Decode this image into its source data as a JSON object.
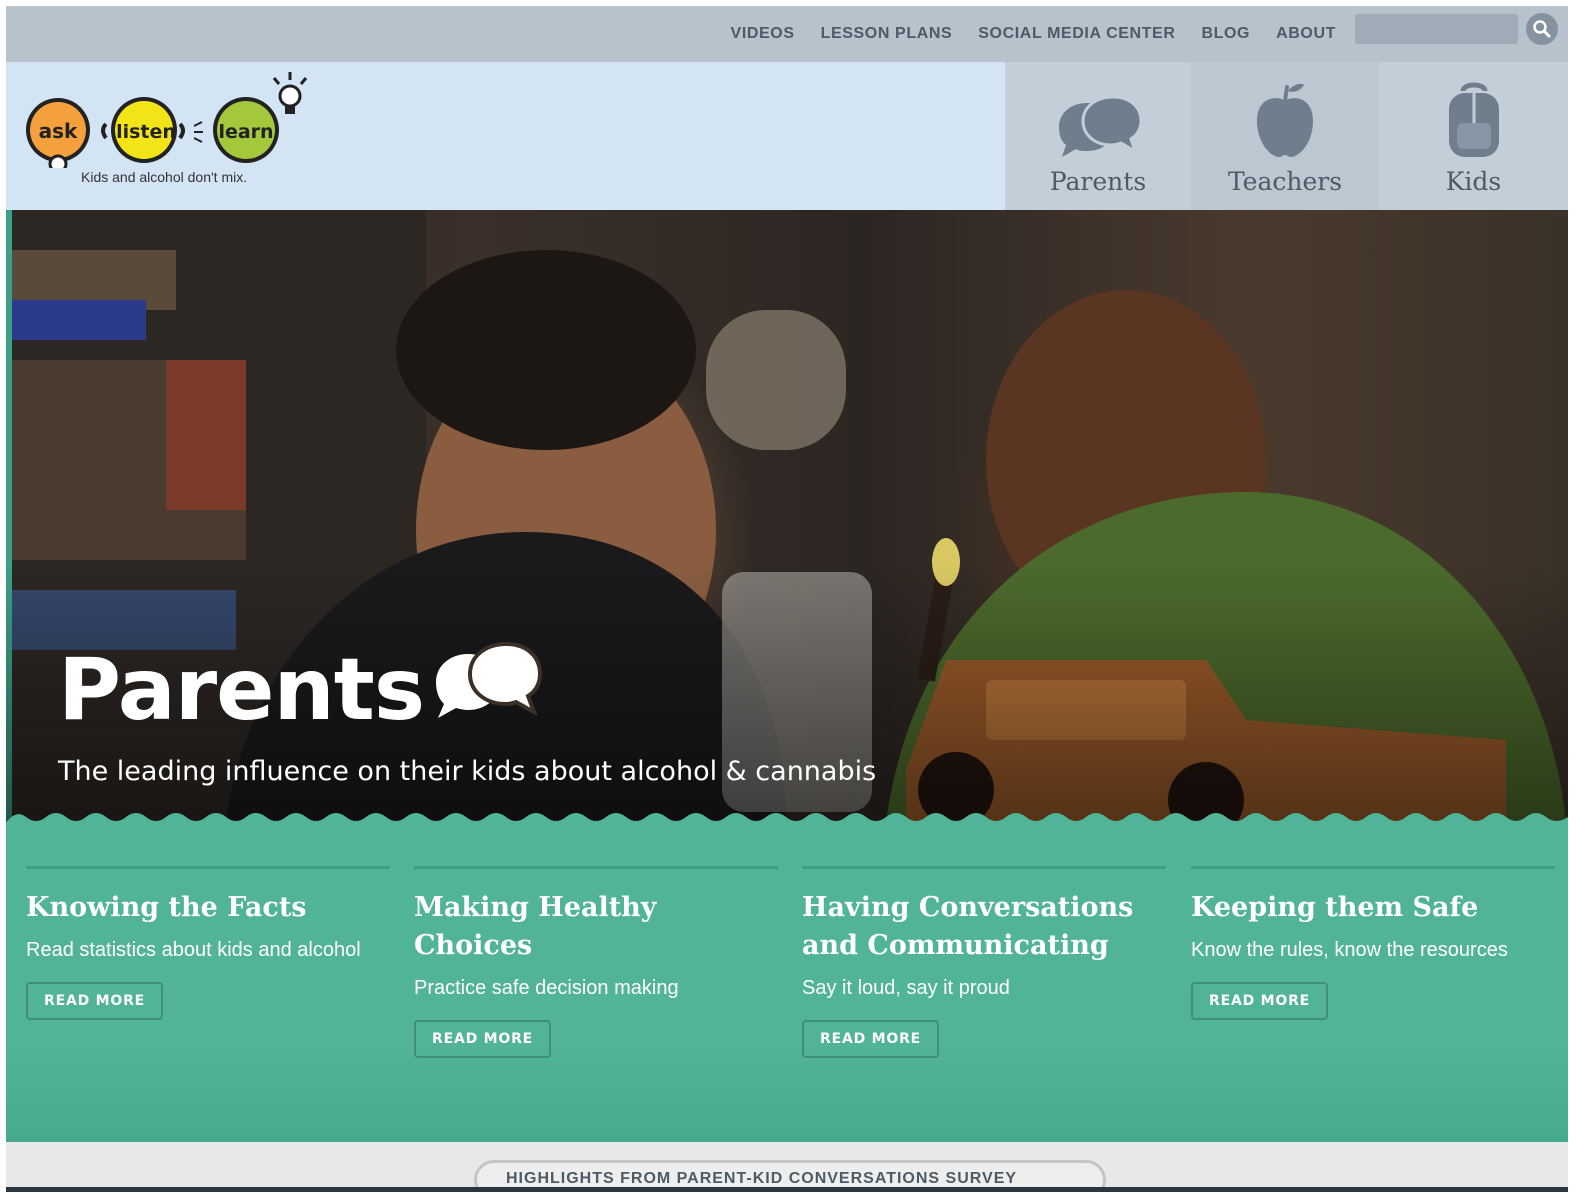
{
  "topnav": {
    "items": [
      "VIDEOS",
      "LESSON PLANS",
      "SOCIAL MEDIA CENTER",
      "BLOG",
      "ABOUT"
    ],
    "search_placeholder": ""
  },
  "header": {
    "logo_words": [
      "ask",
      "listen",
      "learn"
    ],
    "tagline": "Kids and alcohol don't mix.",
    "audience": [
      {
        "label": "Parents",
        "icon": "speech-bubbles-icon"
      },
      {
        "label": "Teachers",
        "icon": "apple-icon"
      },
      {
        "label": "Kids",
        "icon": "backpack-icon"
      }
    ]
  },
  "hero": {
    "title": "Parents",
    "subtitle": "The leading influence on their kids about alcohol & cannabis"
  },
  "topics": [
    {
      "title": "Knowing the Facts",
      "desc": "Read statistics about kids and alcohol",
      "button": "READ MORE"
    },
    {
      "title": "Making Healthy Choices",
      "desc": "Practice safe decision making",
      "button": "READ MORE"
    },
    {
      "title": "Having Conversations and Communicating",
      "desc": "Say it loud, say it proud",
      "button": "READ MORE"
    },
    {
      "title": "Keeping them Safe",
      "desc": "Know the rules, know the resources",
      "button": "READ MORE"
    }
  ],
  "bottom": {
    "banner_text": "HIGHLIGHTS FROM PARENT-KID CONVERSATIONS SURVEY"
  },
  "colors": {
    "topbar": "#b7c2cd",
    "header": "#d3e4f4",
    "green": "#52b497",
    "nav_text": "#4d5b66"
  }
}
